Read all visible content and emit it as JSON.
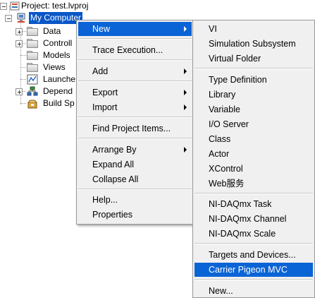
{
  "tree": {
    "project_label": "Project: test.lvproj",
    "root_label": "My Computer",
    "items": [
      {
        "label": "Data",
        "icon": "folder-icon"
      },
      {
        "label": "Controll",
        "icon": "folder-icon"
      },
      {
        "label": "Models",
        "icon": "folder-icon"
      },
      {
        "label": "Views",
        "icon": "folder-icon"
      },
      {
        "label": "Launche",
        "icon": "vi-icon"
      },
      {
        "label": "Depend",
        "icon": "dependencies-icon"
      },
      {
        "label": "Build Sp",
        "icon": "build-specifications-icon"
      }
    ]
  },
  "context_menu": {
    "items": [
      {
        "label": "New",
        "submenu": true,
        "highlighted": true
      },
      {
        "label": "Trace Execution..."
      },
      {
        "label": "Add",
        "submenu": true
      },
      {
        "label": "Export",
        "submenu": true
      },
      {
        "label": "Import",
        "submenu": true
      },
      {
        "label": "Find Project Items..."
      },
      {
        "label": "Arrange By",
        "submenu": true
      },
      {
        "label": "Expand All"
      },
      {
        "label": "Collapse All"
      },
      {
        "label": "Help..."
      },
      {
        "label": "Properties"
      }
    ]
  },
  "new_submenu": {
    "items": [
      {
        "label": "VI"
      },
      {
        "label": "Simulation Subsystem"
      },
      {
        "label": "Virtual Folder"
      },
      {
        "label": "Type Definition"
      },
      {
        "label": "Library"
      },
      {
        "label": "Variable"
      },
      {
        "label": "I/O Server"
      },
      {
        "label": "Class"
      },
      {
        "label": "Actor"
      },
      {
        "label": "XControl"
      },
      {
        "label": "Web服务"
      },
      {
        "label": "NI-DAQmx Task"
      },
      {
        "label": "NI-DAQmx Channel"
      },
      {
        "label": "NI-DAQmx Scale"
      },
      {
        "label": "Targets and Devices..."
      },
      {
        "label": "Carrier Pigeon MVC",
        "highlighted": true
      },
      {
        "label": "New..."
      }
    ]
  },
  "colors": {
    "selection": "#0a57c8",
    "menu_highlight": "#0a64d6",
    "menu_background": "#f0f0f0"
  }
}
